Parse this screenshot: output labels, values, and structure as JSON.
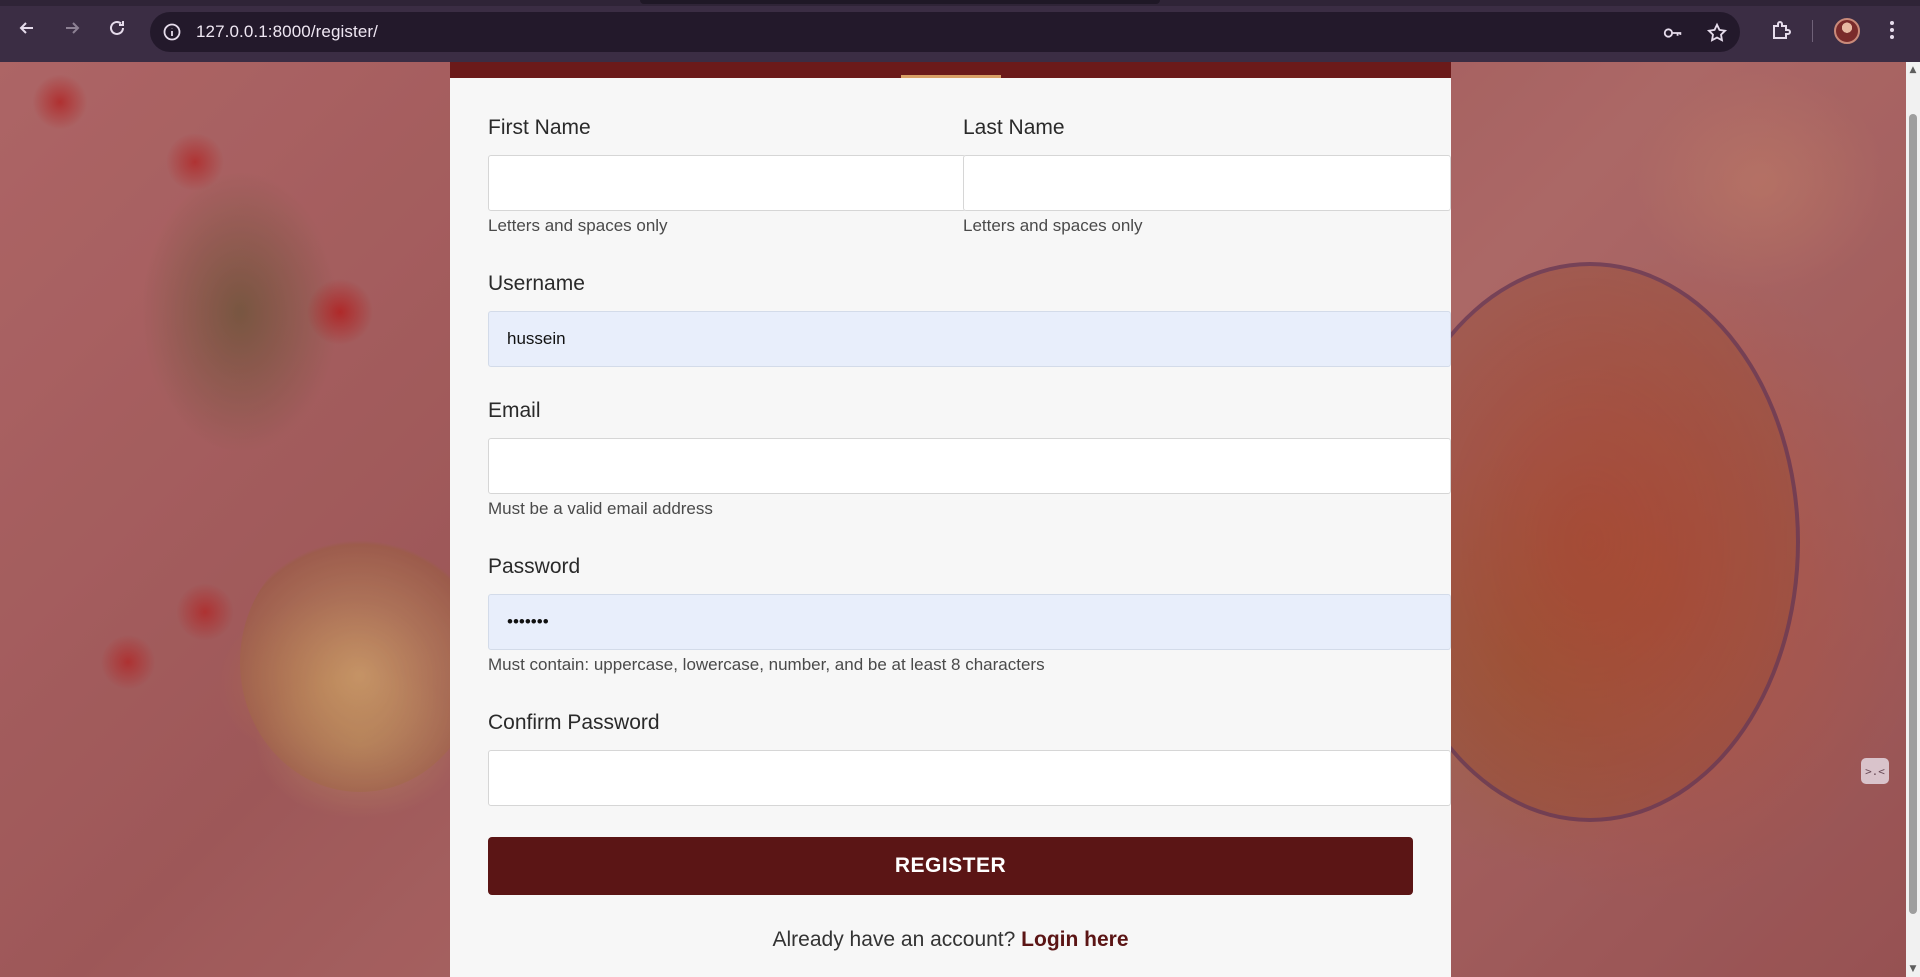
{
  "browser": {
    "url": "127.0.0.1:8000/register/",
    "icons": {
      "back": "back-arrow-icon",
      "forward": "forward-arrow-icon",
      "reload": "reload-icon",
      "site_info": "site-info-icon",
      "password_key": "key-icon",
      "bookmark": "star-icon",
      "extensions": "puzzle-icon",
      "menu": "kebab-menu-icon"
    }
  },
  "form": {
    "first_name": {
      "label": "First Name",
      "value": "",
      "help": "Letters and spaces only"
    },
    "last_name": {
      "label": "Last Name",
      "value": "",
      "help": "Letters and spaces only"
    },
    "username": {
      "label": "Username",
      "value": "hussein"
    },
    "email": {
      "label": "Email",
      "value": "",
      "help": "Must be a valid email address"
    },
    "password": {
      "label": "Password",
      "value": "•••••••",
      "help": "Must contain: uppercase, lowercase, number, and be at least 8 characters"
    },
    "confirm_password": {
      "label": "Confirm Password",
      "value": ""
    },
    "submit_label": "REGISTER",
    "login_prompt": "Already have an account?",
    "login_link": "Login here"
  },
  "side_widget": {
    "glyph": ">.<"
  },
  "colors": {
    "brand": "#5b1515",
    "card_bg": "#f7f7f7",
    "autofill_bg": "#e8eefb",
    "accent": "#d9a066"
  }
}
